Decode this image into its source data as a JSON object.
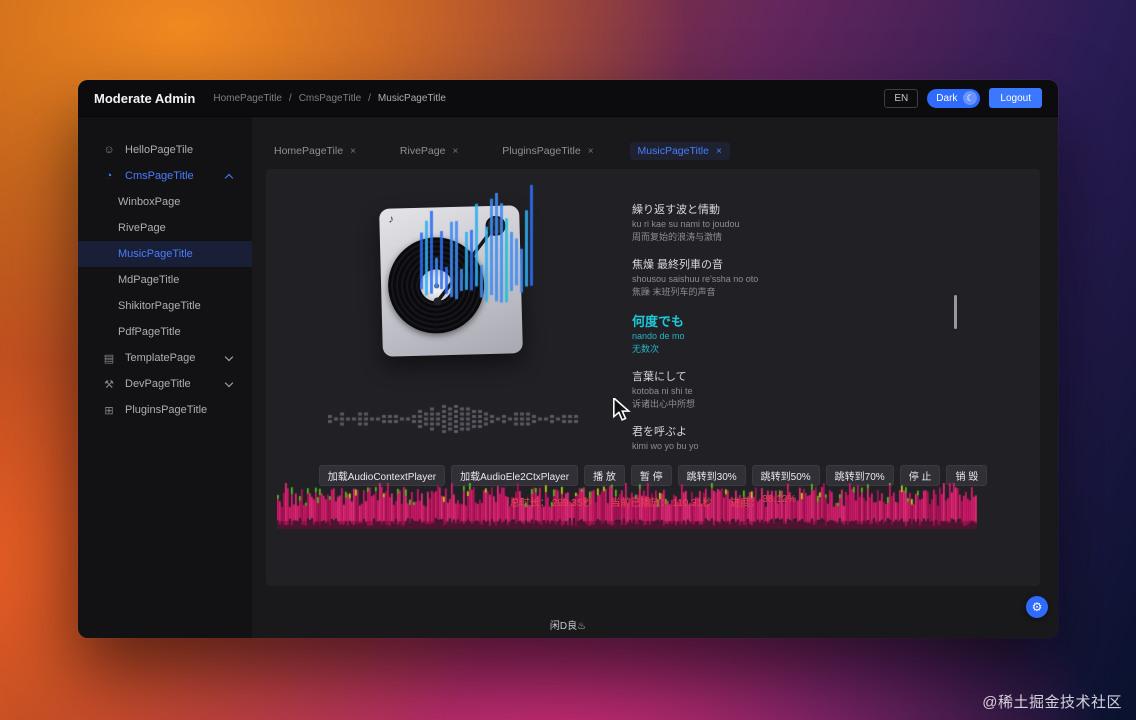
{
  "icons": {
    "hello": "☺",
    "cms": "◔",
    "template": "▤",
    "dev": "⚒",
    "plugins": "⊞",
    "moon": "☾",
    "gear": "⚙",
    "note": "♪",
    "close": "×",
    "sep": "/"
  },
  "watermark": "@稀土掘金技术社区",
  "window": {
    "header": {
      "title": "Moderate Admin",
      "breadcrumb": [
        "HomePageTitle",
        "CmsPageTitle",
        "MusicPageTitle"
      ],
      "lang": "EN",
      "theme": "Dark",
      "logout": "Logout"
    },
    "sidebar": {
      "items": [
        {
          "label": "HelloPageTile"
        },
        {
          "label": "CmsPageTitle"
        },
        {
          "label": "WinboxPage"
        },
        {
          "label": "RivePage"
        },
        {
          "label": "MusicPageTitle"
        },
        {
          "label": "MdPageTitle"
        },
        {
          "label": "ShikitorPageTitle"
        },
        {
          "label": "PdfPageTitle"
        },
        {
          "label": "TemplatePage"
        },
        {
          "label": "DevPageTitle"
        },
        {
          "label": "PluginsPageTitle"
        }
      ]
    },
    "tabs": [
      {
        "label": "HomePageTile"
      },
      {
        "label": "RivePage"
      },
      {
        "label": "PluginsPageTitle"
      },
      {
        "label": "MusicPageTitle"
      }
    ],
    "player": {
      "lyrics": [
        {
          "jp": "繰り返す波と情動",
          "romaji": "ku ri kae su nami to joudou",
          "cn": "周而复始的浪涛与激情"
        },
        {
          "jp": "焦燥 最終列車の音",
          "romaji": "shousou saishuu re'ssha no oto",
          "cn": "焦躁 末班列车的声音"
        },
        {
          "jp": "何度でも",
          "romaji": "nando de mo",
          "cn": "无数次"
        },
        {
          "jp": "言葉にして",
          "romaji": "kotoba ni shi te",
          "cn": "诉诸出心中所想"
        },
        {
          "jp": "君を呼ぶよ",
          "romaji": "kimi wo yo bu yo",
          "cn": ""
        }
      ],
      "buttons": [
        "加载AudioContextPlayer",
        "加载AudioEle2CtxPlayer",
        "播 放",
        "暂 停",
        "跳转到30%",
        "跳转到50%",
        "跳转到70%",
        "停 止",
        "销 毁"
      ],
      "stats": [
        {
          "label": "总时长：",
          "value": "289.35秒"
        },
        {
          "label": "当前已播放：",
          "value": "110.31秒"
        },
        {
          "label": "进度：",
          "value": "38.12%"
        }
      ]
    },
    "footer": "闲D良♨"
  },
  "colors": {
    "accent_blue": "#4a7dff",
    "active_lyric": "#1fc8db",
    "status_red": "#e5484d",
    "waveform_pink": "#e0186e"
  }
}
